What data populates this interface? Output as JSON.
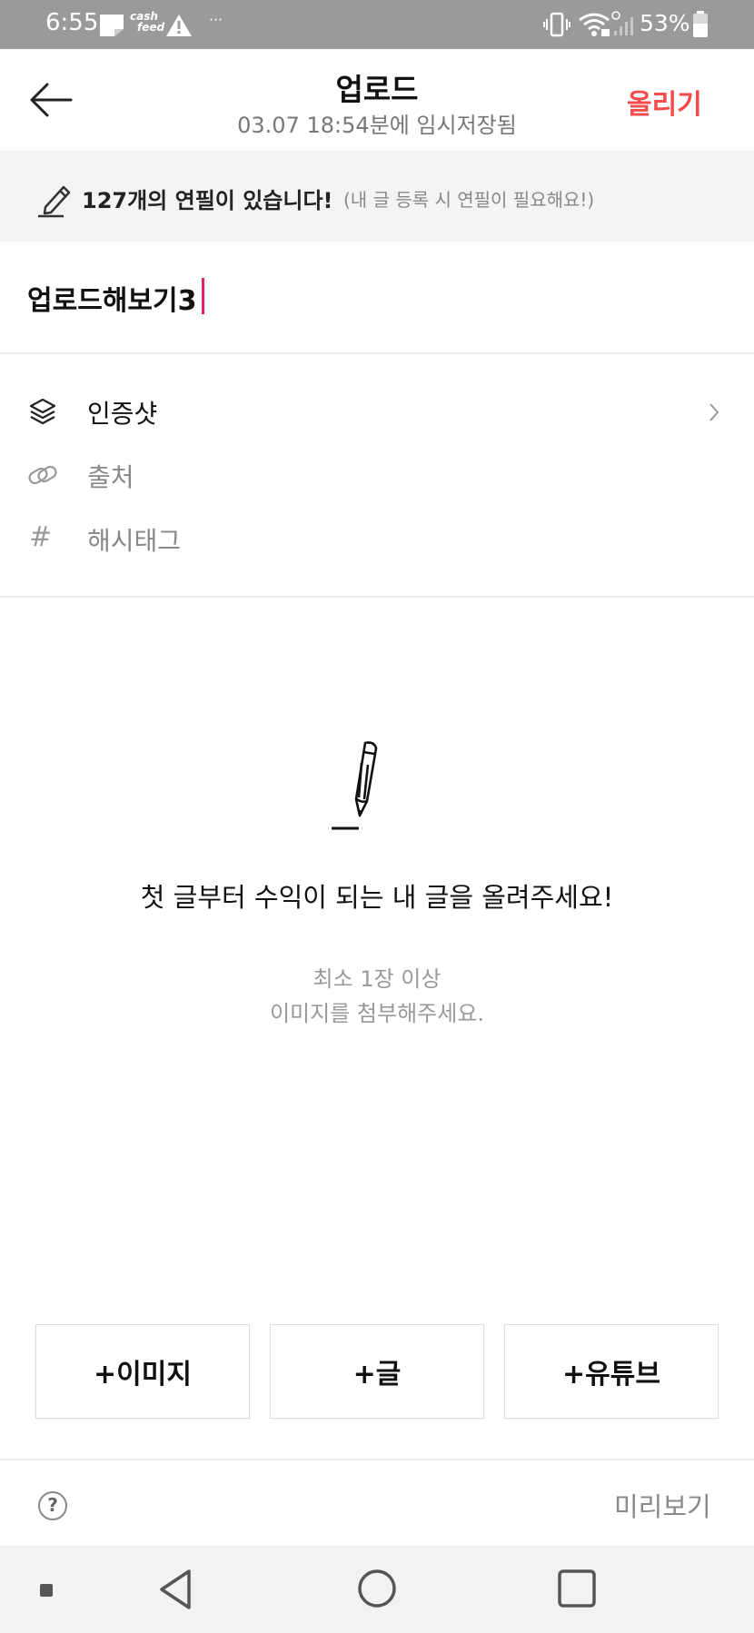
{
  "status_bar": {
    "time": "6:55",
    "cashfeed_label_top": "cash",
    "cashfeed_label_bottom": "feed",
    "more": "···",
    "battery_percent": "53%"
  },
  "header": {
    "title": "업로드",
    "subtitle": "03.07 18:54분에 임시저장됨",
    "upload_label": "올리기",
    "upload_color": "#f24b4b"
  },
  "banner": {
    "count_text": "127개의 연필이 있습니다!",
    "note": "(내 글 등록 시 연필이 필요해요!)"
  },
  "editor": {
    "title_value": "업로드해보기3",
    "caret_color": "#e0226b"
  },
  "options": [
    {
      "label": "인증샷",
      "icon": "layers-icon"
    },
    {
      "label": "출처",
      "icon": "link-icon"
    },
    {
      "label": "해시태그",
      "icon": "hash-icon",
      "glyph": "#"
    }
  ],
  "empty_state": {
    "title": "첫 글부터 수익이 되는 내 글을 올려주세요!",
    "line1": "최소 1장 이상",
    "line2": "이미지를 첨부해주세요."
  },
  "add_buttons": [
    {
      "label": "+이미지"
    },
    {
      "label": "+글"
    },
    {
      "label": "+유튜브"
    }
  ],
  "footer": {
    "help_glyph": "?",
    "preview_label": "미리보기"
  }
}
